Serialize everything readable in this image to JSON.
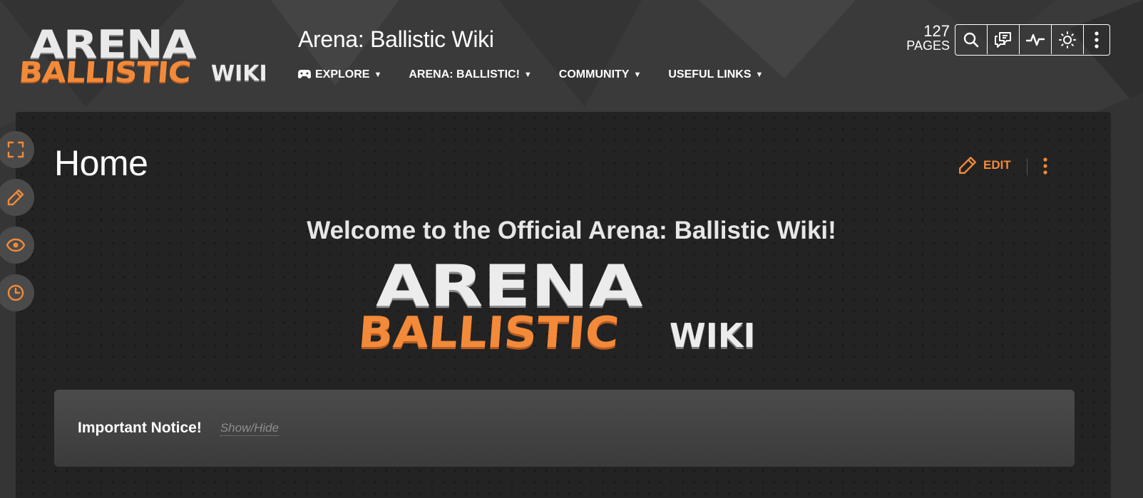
{
  "site": {
    "logo": {
      "line1": "ARENA",
      "line2": "BALLISTIC",
      "line3": "WIKI"
    },
    "title": "Arena: Ballistic Wiki"
  },
  "nav": [
    {
      "label": "EXPLORE",
      "icon": "gamepad-icon"
    },
    {
      "label": "ARENA: BALLISTIC!"
    },
    {
      "label": "COMMUNITY"
    },
    {
      "label": "USEFUL LINKS"
    }
  ],
  "stats": {
    "count": "127",
    "label": "PAGES"
  },
  "toolbar": {
    "icons": [
      "search-icon",
      "discussions-icon",
      "activity-icon",
      "theme-toggle-icon",
      "more-icon"
    ]
  },
  "side_tools": [
    "fullscreen-icon",
    "edit-pencil-icon",
    "watch-eye-icon",
    "history-clock-icon"
  ],
  "page": {
    "title": "Home",
    "edit_label": "EDIT",
    "welcome": "Welcome to the Official Arena: Ballistic Wiki!",
    "logo": {
      "line1": "ARENA",
      "line2": "BALLISTIC",
      "line3": "WIKI"
    },
    "notice": {
      "title": "Important Notice!",
      "toggle": "Show/Hide"
    }
  },
  "colors": {
    "accent": "#f28a3a",
    "panel": "#232323",
    "background": "#3a3a3a"
  }
}
